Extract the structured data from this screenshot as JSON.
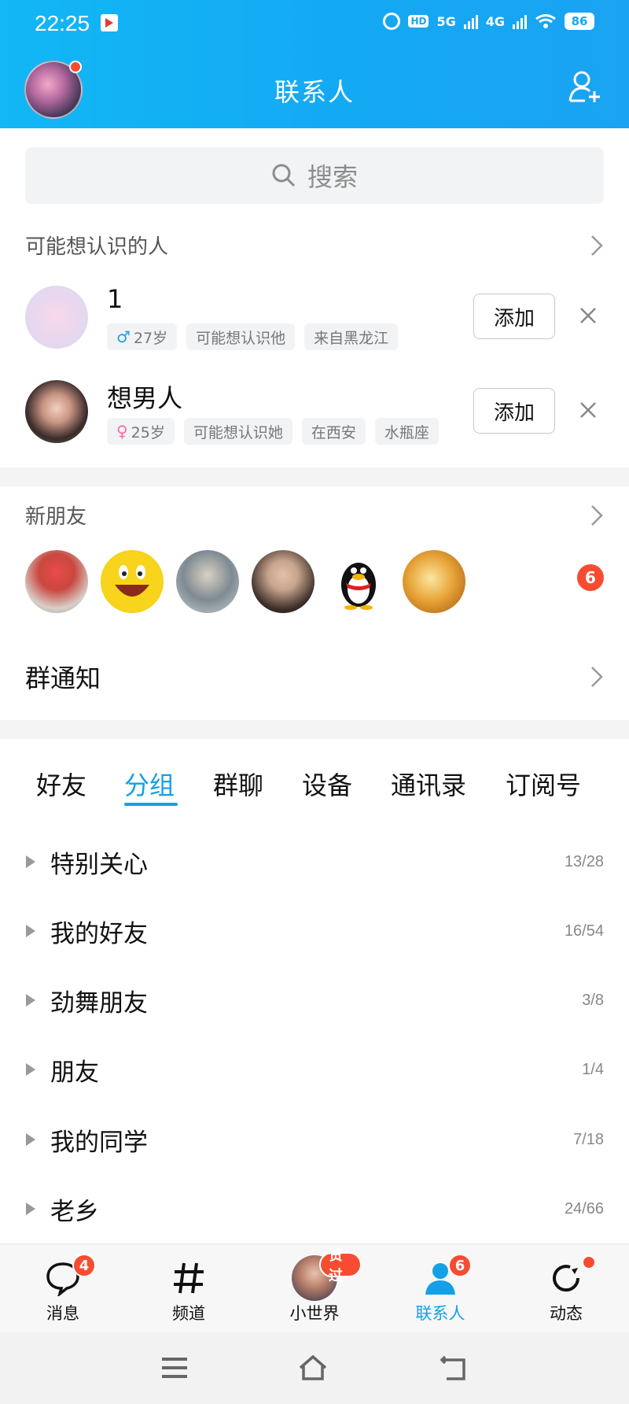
{
  "status_bar": {
    "time": "22:25",
    "network_1": "5G",
    "network_2": "4G",
    "battery": "86",
    "hd_label": "HD"
  },
  "header": {
    "title": "联系人"
  },
  "search": {
    "placeholder": "搜索"
  },
  "recommend": {
    "title": "可能想认识的人",
    "people": [
      {
        "name": "1",
        "gender": "♂",
        "age": "27岁",
        "tags": [
          "可能想认识他",
          "来自黑龙江"
        ],
        "button": "添加"
      },
      {
        "name": "想男人",
        "gender": "♀",
        "age": "25岁",
        "tags": [
          "可能想认识她",
          "在西安",
          "水瓶座"
        ],
        "button": "添加"
      }
    ]
  },
  "new_friends": {
    "title": "新朋友",
    "badge": "6"
  },
  "group_notice": {
    "label": "群通知"
  },
  "tabs": [
    {
      "label": "好友",
      "active": false
    },
    {
      "label": "分组",
      "active": true
    },
    {
      "label": "群聊",
      "active": false
    },
    {
      "label": "设备",
      "active": false
    },
    {
      "label": "通讯录",
      "active": false
    },
    {
      "label": "订阅号",
      "active": false
    }
  ],
  "groups": [
    {
      "name": "特别关心",
      "count": "13/28"
    },
    {
      "name": "我的好友",
      "count": "16/54"
    },
    {
      "name": "劲舞朋友",
      "count": "3/8"
    },
    {
      "name": "朋友",
      "count": "1/4"
    },
    {
      "name": "我的同学",
      "count": "7/18"
    },
    {
      "name": "老乡",
      "count": "24/66"
    }
  ],
  "bottom_nav": [
    {
      "label": "消息",
      "icon": "chat-bubble-icon",
      "badge": "4",
      "active": false
    },
    {
      "label": "频道",
      "icon": "hash-icon",
      "badge": "",
      "active": false
    },
    {
      "label": "小世界",
      "icon": "small-world-avatar",
      "badge": "赞过",
      "active": false
    },
    {
      "label": "联系人",
      "icon": "contacts-icon",
      "badge": "6",
      "active": true
    },
    {
      "label": "动态",
      "icon": "refresh-star-icon",
      "badge": "",
      "active": false
    }
  ],
  "colors": {
    "accent": "#14a0e6",
    "header": "#12b7f5",
    "badge": "#f74c31"
  }
}
